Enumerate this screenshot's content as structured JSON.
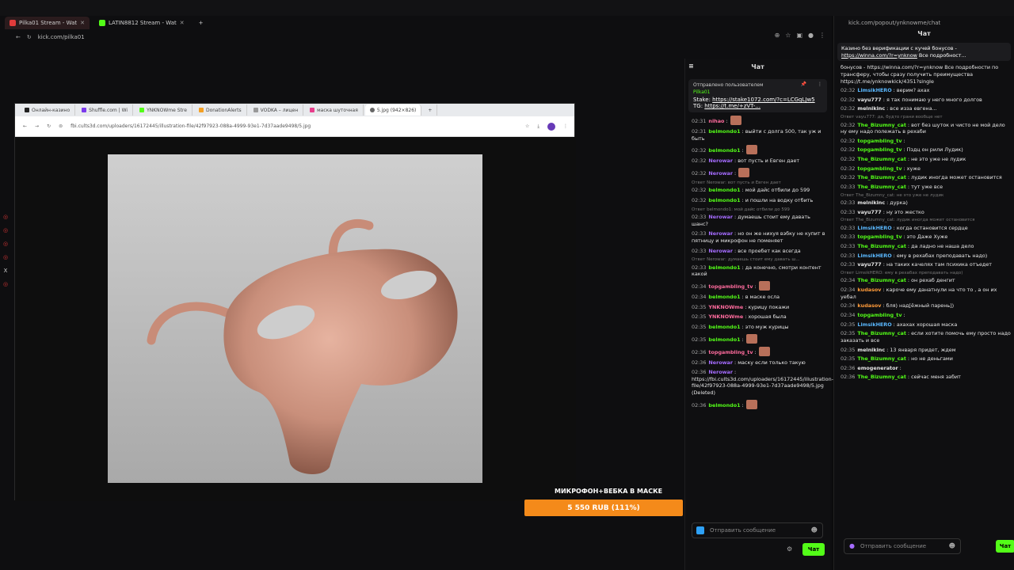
{
  "browser": {
    "tabs": [
      {
        "label": "Pilka01 Stream - Wat",
        "fav": "kick-icon",
        "active": true
      },
      {
        "label": "LATIN8812 Stream - Wat",
        "fav": "kick-icon",
        "active": false
      }
    ],
    "url": "kick.com/pilka01"
  },
  "inner_browser": {
    "tabs": [
      "Онлайн-казино",
      "Shuffle.com | Wi",
      "YNKNOWme Stre",
      "DonationAlerts",
      "VODKA – лицен",
      "маска шуточная",
      "5.jpg (942×826)"
    ],
    "url": "fbi.cults3d.com/uploaders/16172445/illustration-file/42f97923-088a-4999-93e1-7d37aade9498/5.jpg"
  },
  "goal": {
    "banner": "МИКРОФОН+ВЕБКА В МАСКЕ",
    "progress": "5 550 RUB (111%)"
  },
  "chat1": {
    "title": "Чат",
    "pinned_label": "Отправлено пользователем",
    "pinned_user": "Pilka01",
    "pinned_body": "Stake: ",
    "pinned_link1": "https://stake1072.com/?c=LCGqLJw5",
    "pinned_tg": " TG: ",
    "pinned_link2": "https://t.me/+zVT-...",
    "input_placeholder": "Отправить сообщение",
    "send_label": "Чат",
    "messages": [
      {
        "t": "02:31",
        "u": "nihao",
        "c": "#ff6b9d",
        "text": ":",
        "emote": true,
        "reply": ""
      },
      {
        "t": "02:31",
        "u": "belmondo1",
        "c": "#53fc18",
        "text": ": выйти с долга 500, так уж и быть",
        "emote": false,
        "reply": ""
      },
      {
        "t": "02:32",
        "u": "belmondo1",
        "c": "#53fc18",
        "text": ":",
        "emote": true,
        "reply": ""
      },
      {
        "t": "02:32",
        "u": "Nerowar",
        "c": "#a56cff",
        "text": ": вот пусть и Евген дает",
        "emote": false,
        "reply": ""
      },
      {
        "t": "02:32",
        "u": "Nerowar",
        "c": "#a56cff",
        "text": ":",
        "emote": true,
        "reply": ""
      },
      {
        "t": "02:32",
        "u": "belmondo1",
        "c": "#53fc18",
        "text": ": мой дайс отбили до 599",
        "emote": false,
        "reply": "Ответ Nerowar: вот пусть и Евген дает"
      },
      {
        "t": "02:32",
        "u": "belmondo1",
        "c": "#53fc18",
        "text": ": и пошли на водку отбить",
        "emote": false,
        "reply": ""
      },
      {
        "t": "02:33",
        "u": "Nerowar",
        "c": "#a56cff",
        "text": ": думаешь стоит ему давать шанс?",
        "emote": false,
        "reply": "Ответ belmondo1: мой дайс отбили до 599"
      },
      {
        "t": "02:33",
        "u": "Nerowar",
        "c": "#a56cff",
        "text": ": но он же нихуя вэбку не купит в пятницу и микрофон не поменяет",
        "emote": false,
        "reply": ""
      },
      {
        "t": "02:33",
        "u": "Nerowar",
        "c": "#a56cff",
        "text": ": все проебет как всегда",
        "emote": false,
        "reply": ""
      },
      {
        "t": "02:33",
        "u": "belmondo1",
        "c": "#53fc18",
        "text": ": да конечно, смотри контент какой",
        "emote": false,
        "reply": "Ответ Nerowar: думаешь стоит ему давать ш..."
      },
      {
        "t": "02:34",
        "u": "topgambling_tv",
        "c": "#ff6b9d",
        "text": ":",
        "emote": true,
        "reply": ""
      },
      {
        "t": "02:34",
        "u": "belmondo1",
        "c": "#53fc18",
        "text": ": в маске осла",
        "emote": false,
        "reply": ""
      },
      {
        "t": "02:35",
        "u": "YNKNOWme",
        "c": "#ff6b9d",
        "text": ": курицу покажи",
        "emote": false,
        "reply": ""
      },
      {
        "t": "02:35",
        "u": "YNKNOWme",
        "c": "#ff6b9d",
        "text": ": хорошая была",
        "emote": false,
        "reply": ""
      },
      {
        "t": "02:35",
        "u": "belmondo1",
        "c": "#53fc18",
        "text": ": это муж курицы",
        "emote": false,
        "reply": ""
      },
      {
        "t": "02:35",
        "u": "belmondo1",
        "c": "#53fc18",
        "text": ":",
        "emote": true,
        "reply": ""
      },
      {
        "t": "02:36",
        "u": "topgambling_tv",
        "c": "#ff6b9d",
        "text": ":",
        "emote": true,
        "reply": ""
      },
      {
        "t": "02:36",
        "u": "Nerowar",
        "c": "#a56cff",
        "text": ": маску если только такую",
        "emote": false,
        "reply": ""
      },
      {
        "t": "02:36",
        "u": "Nerowar",
        "c": "#a56cff",
        "text": ": https://fbi.cults3d.com/uploaders/16172445/illustration-file/42f97923-088a-4999-93e1-7d37aade9498/5.jpg (Deleted)",
        "emote": false,
        "reply": ""
      },
      {
        "t": "02:36",
        "u": "belmondo1",
        "c": "#53fc18",
        "text": ":",
        "emote": true,
        "reply": ""
      }
    ]
  },
  "chat2": {
    "url": "kick.com/popout/ynknowme/chat",
    "title": "Чат",
    "pinned_text": "Казино без верификации с кучей бонусов - ",
    "pinned_link": "https://winna.com/?r=ynknow",
    "pinned_tail": " Все подробност...",
    "input_placeholder": "Отправить сообщение",
    "send_label": "Чат",
    "messages": [
      {
        "t": "",
        "u": "",
        "c": "#fff",
        "text": "бонусов - https://winna.com/?r=ynknow Все подробности по трансферу, чтобы сразу получить преимущества https://t.me/ynknowkick/4351?single",
        "reply": ""
      },
      {
        "t": "02:32",
        "u": "LimsikHERO",
        "c": "#5ab8ff",
        "text": ": верим? ахах",
        "reply": ""
      },
      {
        "t": "02:32",
        "u": "vayu777",
        "c": "#e6e6e6",
        "text": ": я так понимаю у него много долгов",
        "reply": ""
      },
      {
        "t": "02:32",
        "u": "melnikinc",
        "c": "#e6e6e6",
        "text": ": все изза евгена...",
        "reply": ""
      },
      {
        "t": "02:32",
        "u": "The_Bizumny_cat",
        "c": "#53fc18",
        "text": ": вот без шуток и чисто не мой дело ну ему надо полежать в рехаби",
        "reply": "Ответ vayu777: да, будто грани вообще нет"
      },
      {
        "t": "02:32",
        "u": "topgambling_tv",
        "c": "#53fc18",
        "text": ":",
        "reply": ""
      },
      {
        "t": "02:32",
        "u": "topgambling_tv",
        "c": "#53fc18",
        "text": ": Пздц он рили Лудик)",
        "reply": ""
      },
      {
        "t": "02:32",
        "u": "The_Bizumny_cat",
        "c": "#53fc18",
        "text": ": не это уже не лудик",
        "reply": ""
      },
      {
        "t": "02:32",
        "u": "topgambling_tv",
        "c": "#53fc18",
        "text": ": хуже",
        "reply": ""
      },
      {
        "t": "02:32",
        "u": "The_Bizumny_cat",
        "c": "#53fc18",
        "text": ": лудик иногда может остановится",
        "reply": ""
      },
      {
        "t": "02:33",
        "u": "The_Bizumny_cat",
        "c": "#53fc18",
        "text": ": тут уже все",
        "reply": ""
      },
      {
        "t": "02:33",
        "u": "melnikinc",
        "c": "#e6e6e6",
        "text": ": дурка)",
        "reply": "Ответ The_Bizumny_cat: не это уже не лудик"
      },
      {
        "t": "02:33",
        "u": "vayu777",
        "c": "#e6e6e6",
        "text": ": ну это жестко",
        "reply": ""
      },
      {
        "t": "02:33",
        "u": "LimsikHERO",
        "c": "#5ab8ff",
        "text": ": когда остановится сердце",
        "reply": "Ответ The_Bizumny_cat: лудик иногда может остановится"
      },
      {
        "t": "02:33",
        "u": "topgambling_tv",
        "c": "#53fc18",
        "text": ": это Даже Хуже",
        "reply": ""
      },
      {
        "t": "02:33",
        "u": "The_Bizumny_cat",
        "c": "#53fc18",
        "text": ": да ладно не наша дело",
        "reply": ""
      },
      {
        "t": "02:33",
        "u": "LimsikHERO",
        "c": "#5ab8ff",
        "text": ": ему в рехабах преподавать надо)",
        "reply": ""
      },
      {
        "t": "02:33",
        "u": "vayu777",
        "c": "#e6e6e6",
        "text": ": на таких качелях там психика отъедет",
        "reply": ""
      },
      {
        "t": "02:34",
        "u": "The_Bizumny_cat",
        "c": "#53fc18",
        "text": ": он рехаб денгит",
        "reply": "Ответ LimsikHERO: ему в рехабах преподавать надо)"
      },
      {
        "t": "02:34",
        "u": "kudasov",
        "c": "#ff9b3a",
        "text": ": кароче ему данатнули на что то , а он их уебал",
        "reply": ""
      },
      {
        "t": "02:34",
        "u": "kudasov",
        "c": "#ff9b3a",
        "text": ": бля) над[ёжный парень])",
        "reply": ""
      },
      {
        "t": "02:34",
        "u": "topgambling_tv",
        "c": "#53fc18",
        "text": ":",
        "reply": ""
      },
      {
        "t": "02:35",
        "u": "LimsikHERO",
        "c": "#5ab8ff",
        "text": ": ахахах хорошая маска",
        "reply": ""
      },
      {
        "t": "02:35",
        "u": "The_Bizumny_cat",
        "c": "#53fc18",
        "text": ": если хотите помочь ему просто надо заказать и все",
        "reply": ""
      },
      {
        "t": "02:35",
        "u": "melnikinc",
        "c": "#e6e6e6",
        "text": ": 13 января придет, ждем",
        "reply": ""
      },
      {
        "t": "02:35",
        "u": "The_Bizumny_cat",
        "c": "#53fc18",
        "text": ": но не деньгами",
        "reply": ""
      },
      {
        "t": "02:36",
        "u": "emogenerator",
        "c": "#e6e6e6",
        "text": ":",
        "reply": ""
      },
      {
        "t": "02:36",
        "u": "The_Bizumny_cat",
        "c": "#53fc18",
        "text": ": сейчас меня забит",
        "reply": ""
      }
    ]
  }
}
